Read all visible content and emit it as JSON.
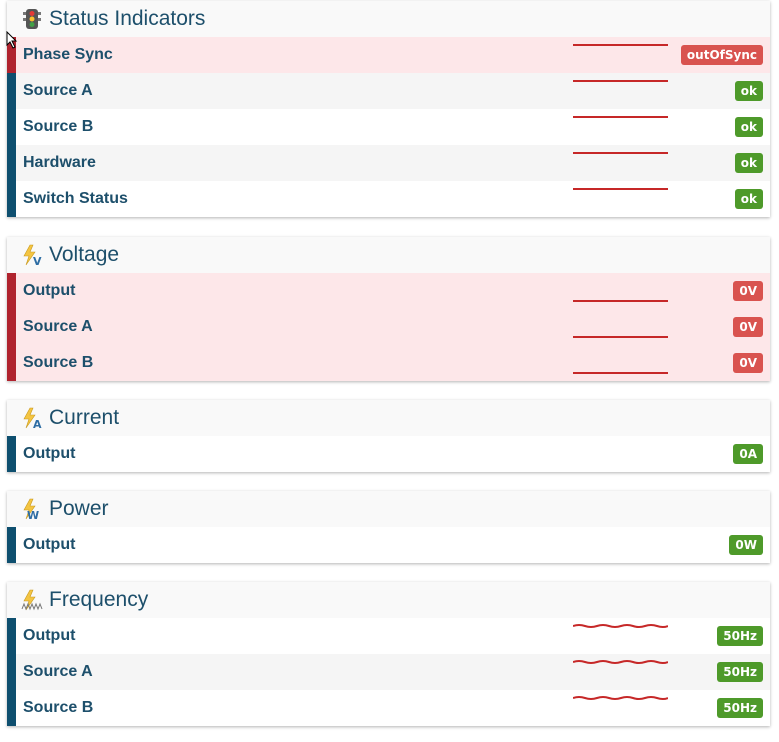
{
  "panels": [
    {
      "title": "Status Indicators",
      "icon": "traffic-light-icon",
      "rows": [
        {
          "label": "Phase Sync",
          "value": "outOfSync",
          "state": "alarm"
        },
        {
          "label": "Source A",
          "value": "ok",
          "state": "ok"
        },
        {
          "label": "Source B",
          "value": "ok",
          "state": "ok"
        },
        {
          "label": "Hardware",
          "value": "ok",
          "state": "ok"
        },
        {
          "label": "Switch Status",
          "value": "ok",
          "state": "ok"
        }
      ]
    },
    {
      "title": "Voltage",
      "icon": "voltage-bolt-icon",
      "rows": [
        {
          "label": "Output",
          "value": "0V",
          "state": "alarm"
        },
        {
          "label": "Source A",
          "value": "0V",
          "state": "alarm"
        },
        {
          "label": "Source B",
          "value": "0V",
          "state": "alarm"
        }
      ]
    },
    {
      "title": "Current",
      "icon": "current-bolt-icon",
      "rows": [
        {
          "label": "Output",
          "value": "0A",
          "state": "ok"
        }
      ]
    },
    {
      "title": "Power",
      "icon": "power-bolt-icon",
      "rows": [
        {
          "label": "Output",
          "value": "0W",
          "state": "ok"
        }
      ]
    },
    {
      "title": "Frequency",
      "icon": "frequency-bolt-icon",
      "rows": [
        {
          "label": "Output",
          "value": "50Hz",
          "state": "ok"
        },
        {
          "label": "Source A",
          "value": "50Hz",
          "state": "ok"
        },
        {
          "label": "Source B",
          "value": "50Hz",
          "state": "ok"
        }
      ]
    }
  ],
  "colors": {
    "ok": "#4e9a2a",
    "alarm": "#d9534f",
    "alarm_row_bg": "#fde7e9",
    "accent_bar": "#0e4f6f",
    "alarm_bar": "#b0232e",
    "title_text": "#1d4f6b",
    "sparkline": "#c62828"
  }
}
